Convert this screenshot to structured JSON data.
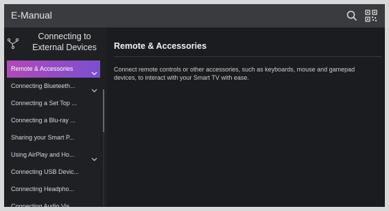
{
  "app": {
    "title": "E-Manual"
  },
  "topbar": {
    "search_icon": "search-icon",
    "qr_icon": "qr-code-icon"
  },
  "sidebar": {
    "header_icon": "branch-connect-icon",
    "title_line1": "Connecting to",
    "title_line2": "External Devices",
    "items": [
      {
        "label": "Remote & Accessories",
        "selected": true,
        "expandable": true
      },
      {
        "label": "Connecting Blueteeth...",
        "selected": false,
        "expandable": true
      },
      {
        "label": "Connecting a Set Top ...",
        "selected": false,
        "expandable": false
      },
      {
        "label": "Connecting a Blu-ray ...",
        "selected": false,
        "expandable": false
      },
      {
        "label": "Sharing your Smart P...",
        "selected": false,
        "expandable": false
      },
      {
        "label": "Using AirPlay and Ho...",
        "selected": false,
        "expandable": true
      },
      {
        "label": "Connecting USB Devic...",
        "selected": false,
        "expandable": false
      },
      {
        "label": "Connecting Headpho...",
        "selected": false,
        "expandable": false
      },
      {
        "label": "Connecting Audio Vis...",
        "selected": false,
        "expandable": false
      }
    ]
  },
  "content": {
    "title": "Remote & Accessories",
    "body": "Connect remote controls or other accessories, such as keyboards, mouse and gamepad devices, to interact with your Smart TV with ease."
  },
  "colors": {
    "accent_start": "#b04ab6",
    "accent_end": "#7b4fd0",
    "background": "#1b1c1f",
    "topbar": "#3a3b3f"
  }
}
